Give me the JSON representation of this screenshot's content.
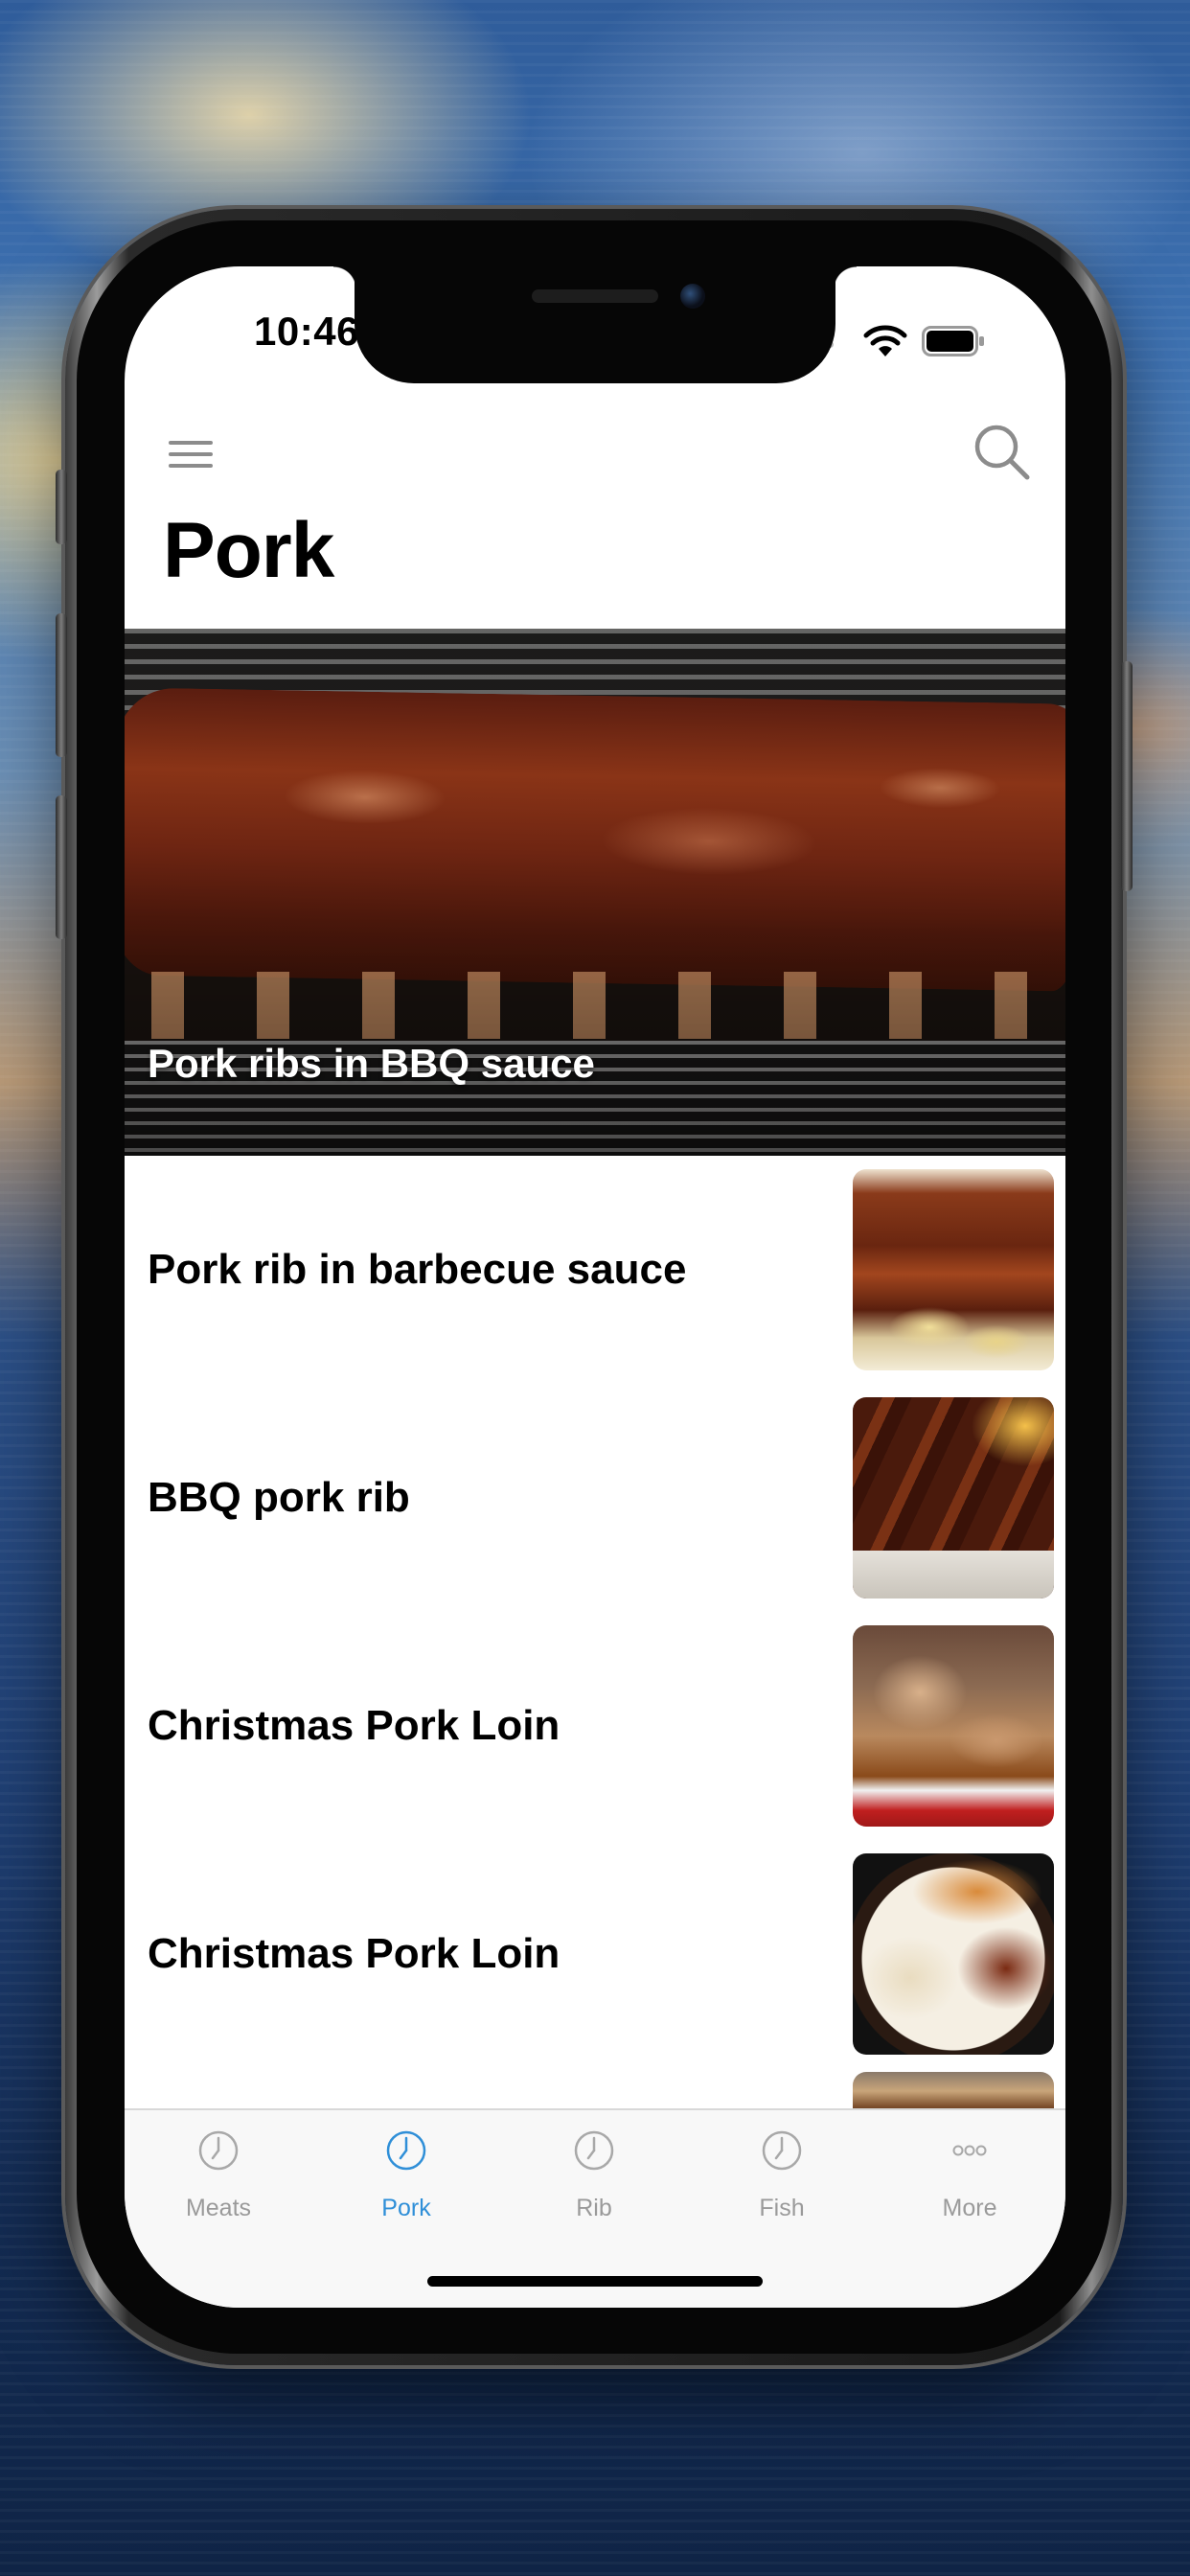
{
  "status_bar": {
    "time": "10:46"
  },
  "nav": {
    "menu_icon": "hamburger-menu-icon",
    "search_icon": "search-icon",
    "title": "Pork"
  },
  "featured": {
    "caption": "Pork ribs in BBQ sauce"
  },
  "recipes": [
    {
      "title": "Pork rib in barbecue sauce"
    },
    {
      "title": "BBQ pork rib"
    },
    {
      "title": "Christmas Pork Loin"
    },
    {
      "title": "Christmas Pork Loin"
    }
  ],
  "tabbar": {
    "tabs": [
      {
        "label": "Meats",
        "icon": "clock-icon",
        "active": false
      },
      {
        "label": "Pork",
        "icon": "clock-icon",
        "active": true
      },
      {
        "label": "Rib",
        "icon": "clock-icon",
        "active": false
      },
      {
        "label": "Fish",
        "icon": "clock-icon",
        "active": false
      },
      {
        "label": "More",
        "icon": "more-dots-icon",
        "active": false
      }
    ]
  },
  "colors": {
    "accent": "#2f8fd8",
    "inactive_tab": "#9a9a9a"
  }
}
